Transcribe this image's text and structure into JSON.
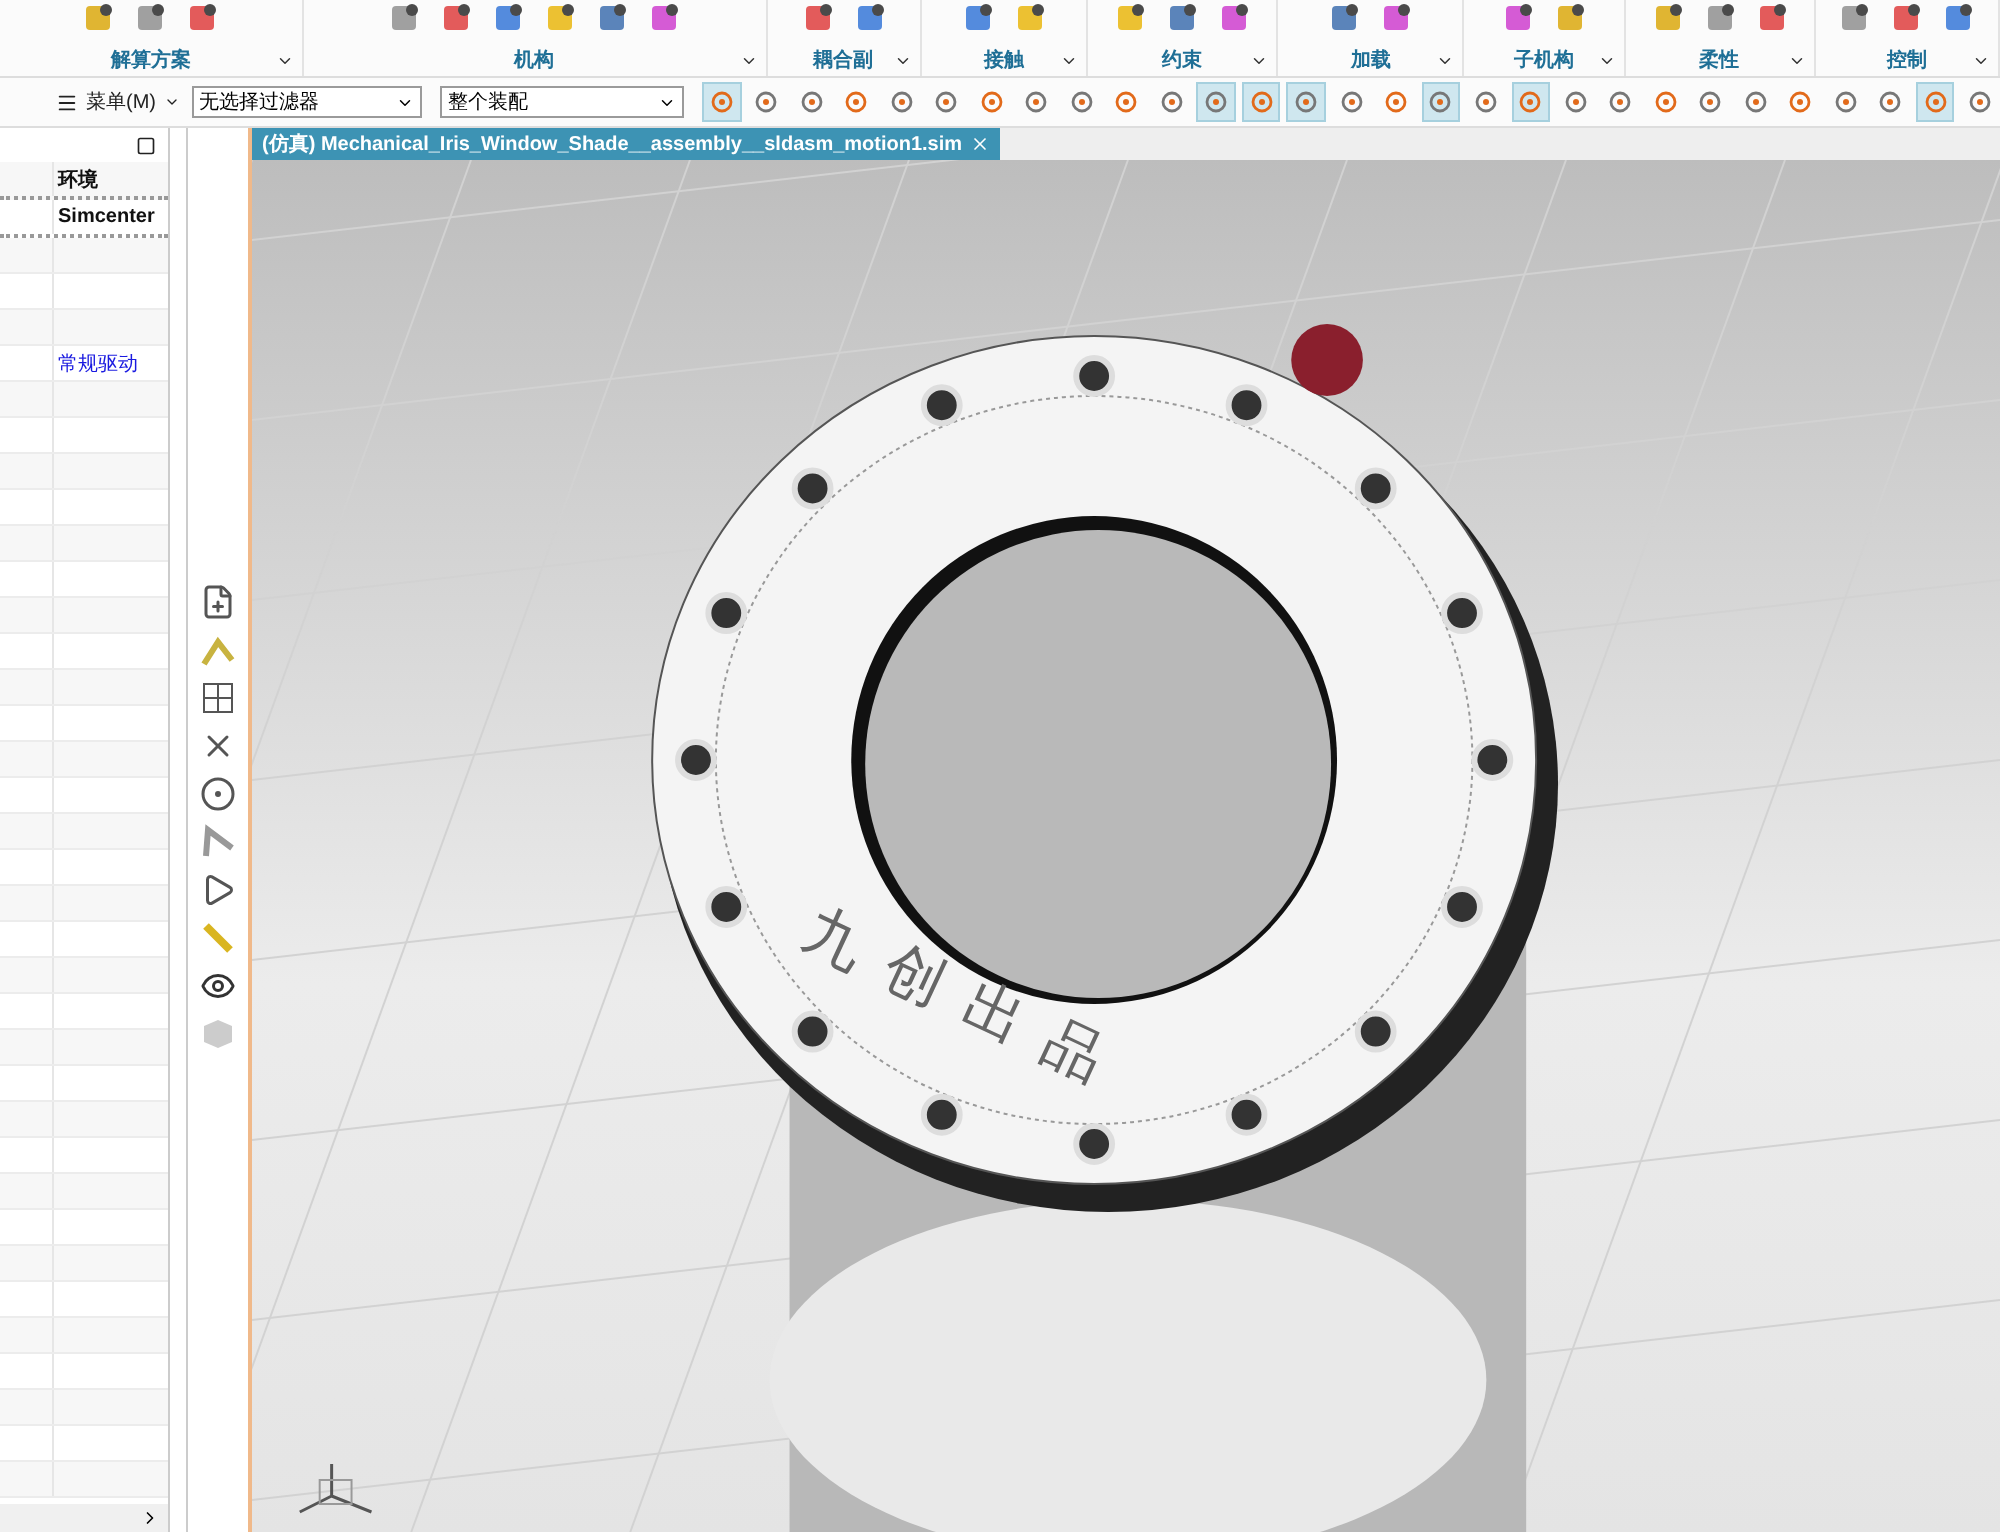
{
  "ribbon": {
    "groups": [
      {
        "label": "解算方案"
      },
      {
        "label": "机构"
      },
      {
        "label": "耦合副"
      },
      {
        "label": "接触"
      },
      {
        "label": "约束"
      },
      {
        "label": "加载"
      },
      {
        "label": "子机构"
      },
      {
        "label": "柔性"
      },
      {
        "label": "控制"
      }
    ]
  },
  "toolbar": {
    "menu": "菜单(M)",
    "selection_filter": "无选择过滤器",
    "assembly_scope": "整个装配",
    "tools": [
      {
        "selected": true
      },
      {
        "selected": false
      },
      {
        "selected": false
      },
      {
        "selected": false
      },
      {
        "selected": false
      },
      {
        "selected": false
      },
      {
        "selected": false
      },
      {
        "selected": false
      },
      {
        "selected": false
      },
      {
        "selected": false
      },
      {
        "selected": false
      },
      {
        "selected": true
      },
      {
        "selected": true
      },
      {
        "selected": true
      },
      {
        "selected": false
      },
      {
        "selected": false
      },
      {
        "selected": true
      },
      {
        "selected": false
      },
      {
        "selected": true
      },
      {
        "selected": false
      },
      {
        "selected": false
      },
      {
        "selected": false
      },
      {
        "selected": false
      },
      {
        "selected": false
      },
      {
        "selected": false
      },
      {
        "selected": false
      },
      {
        "selected": false
      },
      {
        "selected": true
      },
      {
        "selected": false
      }
    ]
  },
  "navigator": {
    "columns": [
      "环境"
    ],
    "rows": [
      {
        "column_2": "Simcenter",
        "kind": "header"
      },
      {
        "kind": "plain"
      },
      {
        "kind": "plain"
      },
      {
        "kind": "plain"
      },
      {
        "column_2": "常规驱动",
        "kind": "link"
      }
    ]
  },
  "document_tab": {
    "title": "(仿真) Mechanical_Iris_Window_Shade__assembly__sldasm_motion1.sim"
  },
  "model": {
    "engraving": "九创出品"
  }
}
